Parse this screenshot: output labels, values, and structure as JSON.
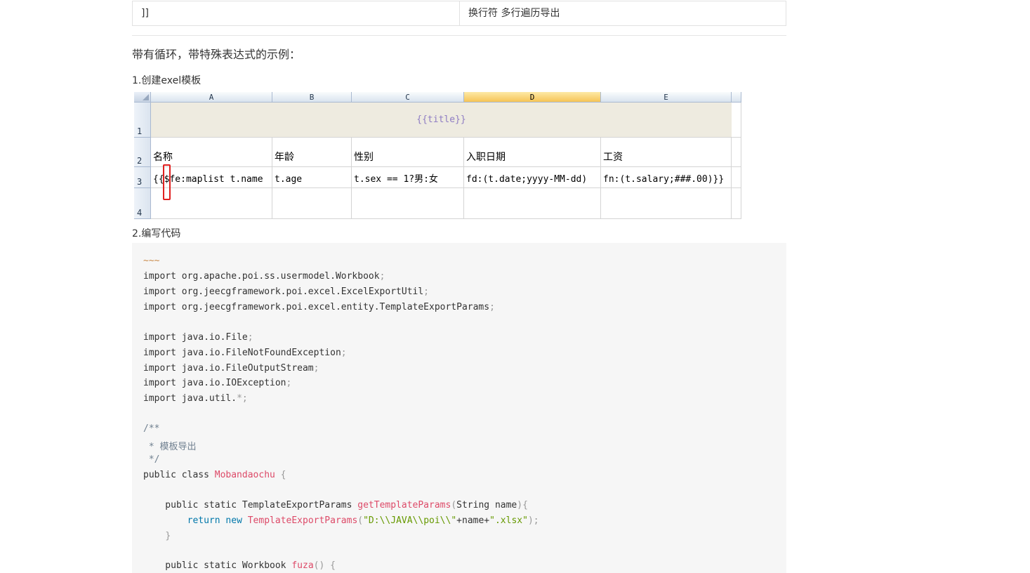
{
  "top_table": {
    "left": "]]",
    "right": "换行符 多行遍历导出"
  },
  "heading": "带有循环，带特殊表达式的示例：",
  "step1": "1.创建exel模板",
  "step2": "2.编写代码",
  "sheet": {
    "columns": [
      "A",
      "B",
      "C",
      "D",
      "E"
    ],
    "rows": [
      "1",
      "2",
      "3",
      "4"
    ],
    "title_cell": "{{title}}",
    "header_row": [
      "名称",
      "年龄",
      "性别",
      "入职日期",
      "工资"
    ],
    "template_row": [
      "{{$fe:maplist t.name",
      "t.age",
      "t.sex == 1?男:女",
      "fd:(t.date;yyyy-MM-dd)",
      "fn:(t.salary;###.00)}}"
    ]
  },
  "code": {
    "fence": "~~~",
    "import1": "org.apache.poi.ss.usermodel.Workbook",
    "import2": "org.jeecgframework.poi.excel.ExcelExportUtil",
    "import3": "org.jeecgframework.poi.excel.entity.TemplateExportParams",
    "import4": "java.io.File",
    "import5": "java.io.FileNotFoundException",
    "import6": "java.io.FileOutputStream",
    "import7": "java.io.IOException",
    "import8": "java.util.",
    "comment_open": "/**",
    "comment_body": " * 模板导出",
    "comment_close": " */",
    "class_name": "Mobandaochu",
    "method1_ret": "TemplateExportParams",
    "method1_name": "getTemplateParams",
    "method1_params": "String name",
    "return_type": "TemplateExportParams",
    "str_path": "\"D:\\\\JAVA\\\\poi\\\\\"",
    "str_ext": "\".xlsx\"",
    "method2_ret": "Workbook",
    "method2_name": "fuza"
  }
}
